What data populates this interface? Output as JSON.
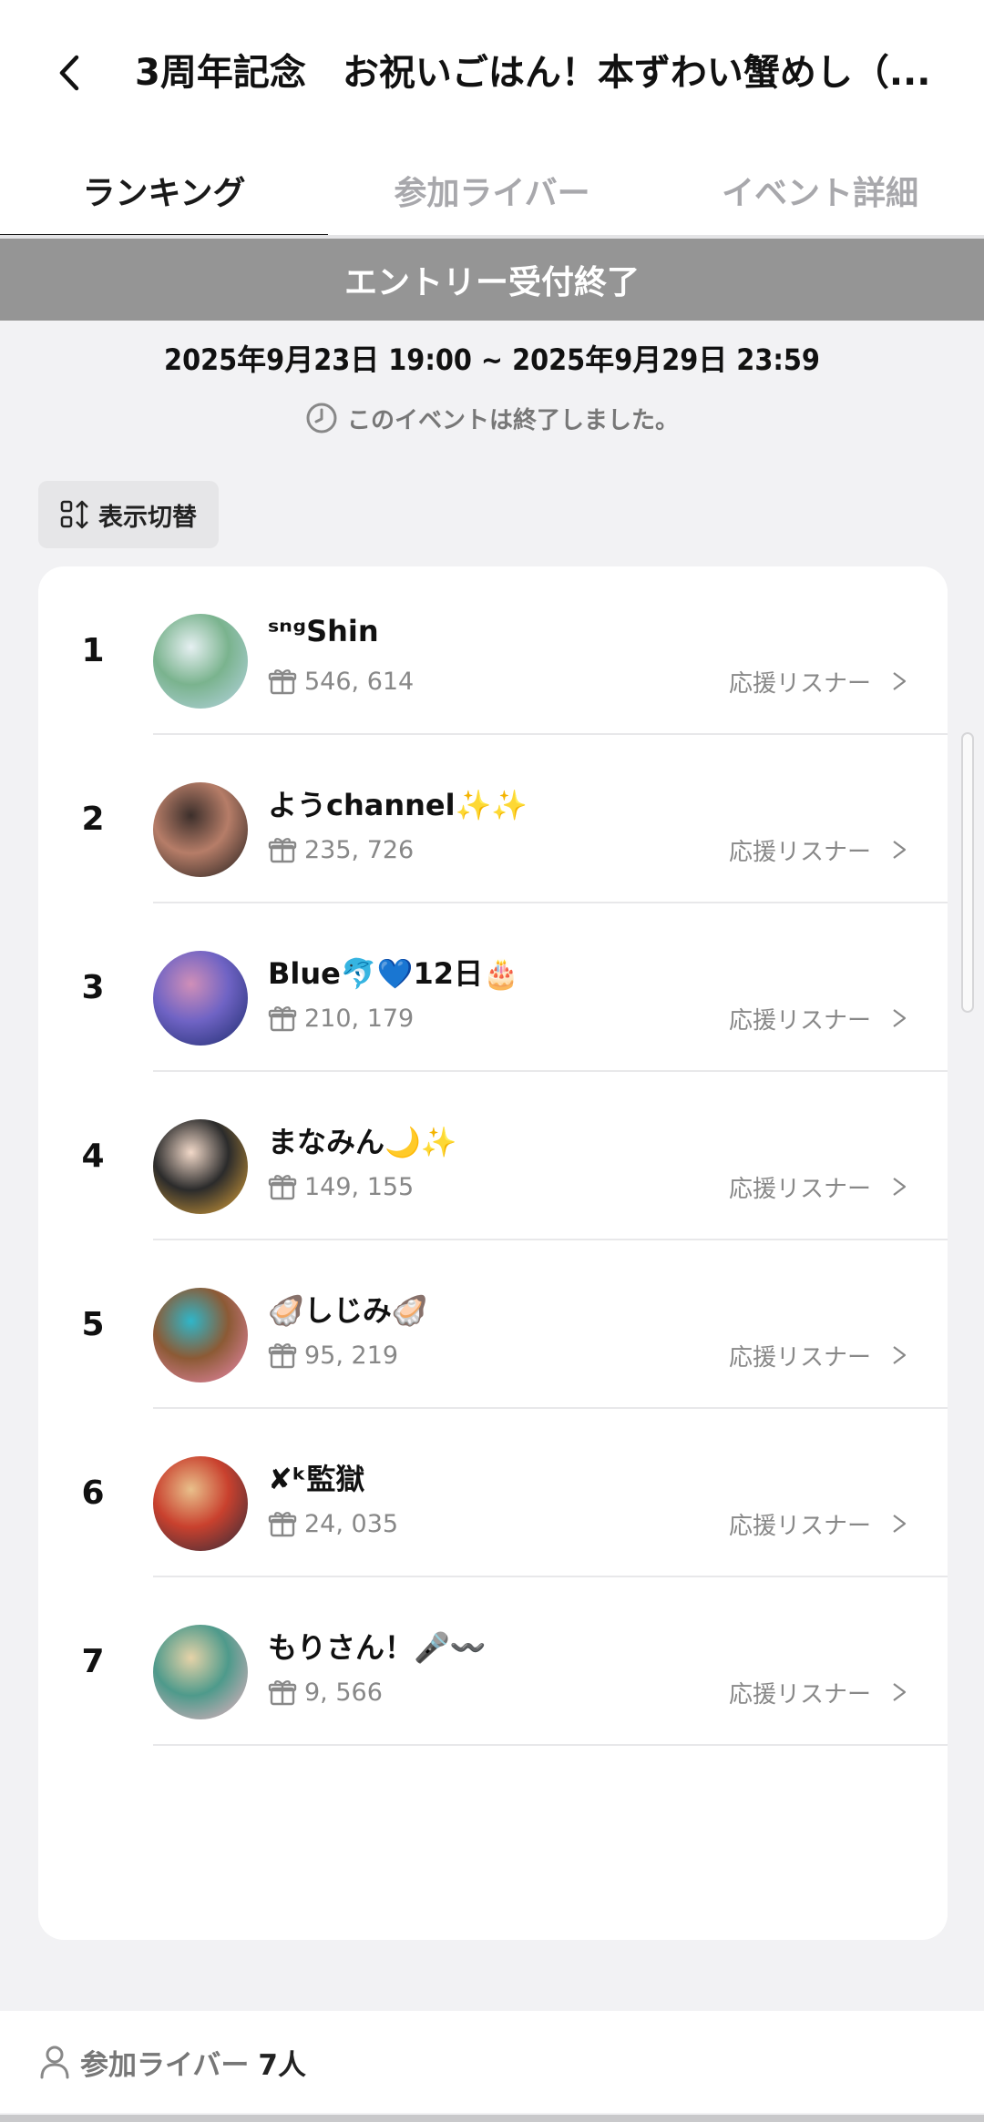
{
  "header": {
    "title": "3周年記念　お祝いごはん！本ずわい蟹めし（..."
  },
  "tabs": [
    {
      "label": "ランキング",
      "active": true
    },
    {
      "label": "参加ライバー",
      "active": false
    },
    {
      "label": "イベント詳細",
      "active": false
    }
  ],
  "banner": {
    "text": "エントリー受付終了"
  },
  "event": {
    "period": "2025年9月23日 19:00 ~ 2025年9月29日 23:59",
    "ended_text": "このイベントは終了しました。"
  },
  "toggle": {
    "label": "表示切替"
  },
  "ranking": [
    {
      "rank": "1",
      "name": "ˢⁿᵍShin",
      "gifts": "546, 614",
      "support_label": "応援リスナー",
      "avatar_colors": [
        "#b9d6e6",
        "#7ab38e",
        "#e6f0f2"
      ]
    },
    {
      "rank": "2",
      "name": "ようchannel✨✨",
      "gifts": "235, 726",
      "support_label": "応援リスナー",
      "avatar_colors": [
        "#1d1a19",
        "#b67d68",
        "#3c2f2b"
      ]
    },
    {
      "rank": "3",
      "name": "Blue🐬💙12日🎂",
      "gifts": "210, 179",
      "support_label": "応援リスナー",
      "avatar_colors": [
        "#1b2a6b",
        "#6f63c4",
        "#d08fb8"
      ]
    },
    {
      "rank": "4",
      "name": "まなみん🌙✨",
      "gifts": "149, 155",
      "support_label": "応援リスナー",
      "avatar_colors": [
        "#e6a93a",
        "#2b2b2b",
        "#f2d9c9"
      ]
    },
    {
      "rank": "5",
      "name": "🦪しじみ🦪",
      "gifts": "95, 219",
      "support_label": "応援リスナー",
      "avatar_colors": [
        "#f08bb3",
        "#8c5a35",
        "#2fb6c9"
      ]
    },
    {
      "rank": "6",
      "name": "✘ᵏ監獄",
      "gifts": "24, 035",
      "support_label": "応援リスナー",
      "avatar_colors": [
        "#2a2a3a",
        "#c9412e",
        "#e9c08b"
      ]
    },
    {
      "rank": "7",
      "name": "もりさん！🎤〰️",
      "gifts": "9, 566",
      "support_label": "応援リスナー",
      "avatar_colors": [
        "#f2b3c4",
        "#4e9a8b",
        "#e6d3a8"
      ]
    }
  ],
  "footer": {
    "label": "参加ライバー",
    "count": "7人"
  }
}
